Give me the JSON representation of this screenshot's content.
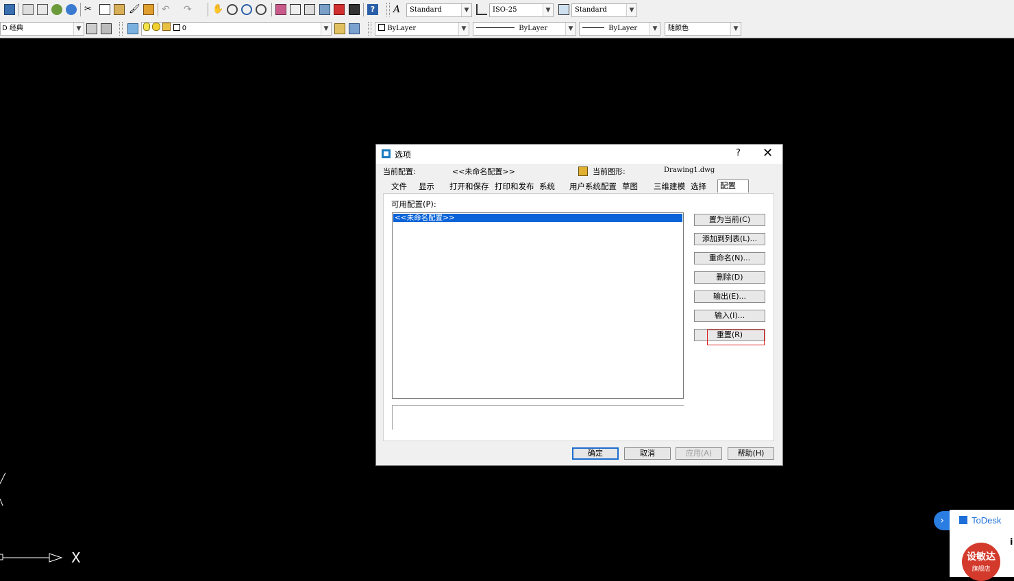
{
  "toolbar1": {
    "text_style": "Standard",
    "dim_style": "ISO-25",
    "table_style": "Standard"
  },
  "toolbar2": {
    "workspace": "经典",
    "workspace_prefix": "D",
    "layer": "0",
    "color": "ByLayer",
    "linetype": "ByLayer",
    "lineweight": "ByLayer",
    "plot_style": "随颜色"
  },
  "dialog": {
    "title": "选项",
    "help_glyph": "?",
    "close_glyph": "✕",
    "current_profile_label": "当前配置:",
    "current_profile_value": "<<未命名配置>>",
    "current_drawing_label": "当前图形:",
    "current_drawing_value": "Drawing1.dwg",
    "tabs": [
      "文件",
      "显示",
      "打开和保存",
      "打印和发布",
      "系统",
      "用户系统配置",
      "草图",
      "三维建模",
      "选择",
      "配置"
    ],
    "active_tab": "配置",
    "available_profiles_label": "可用配置(P):",
    "profiles": [
      "<<未命名配置>>"
    ],
    "side_buttons": [
      "置为当前(C)",
      "添加到列表(L)...",
      "重命名(N)...",
      "删除(D)",
      "输出(E)...",
      "输入(I)...",
      "重置(R)"
    ],
    "bottom_buttons": {
      "ok": "确定",
      "cancel": "取消",
      "apply": "应用(A)",
      "help": "帮助(H)"
    }
  },
  "ucs": {
    "x_label": "X"
  },
  "todesk": {
    "toggle": "›",
    "name": "ToDesk",
    "badge_main": "设敏达",
    "badge_sub": "旗舰店",
    "side_char": "i"
  },
  "colors": {
    "canvas": "#000000",
    "selection": "#0a64d8",
    "highlight_box": "#e02020",
    "todesk_blue": "#1e6fd9"
  }
}
